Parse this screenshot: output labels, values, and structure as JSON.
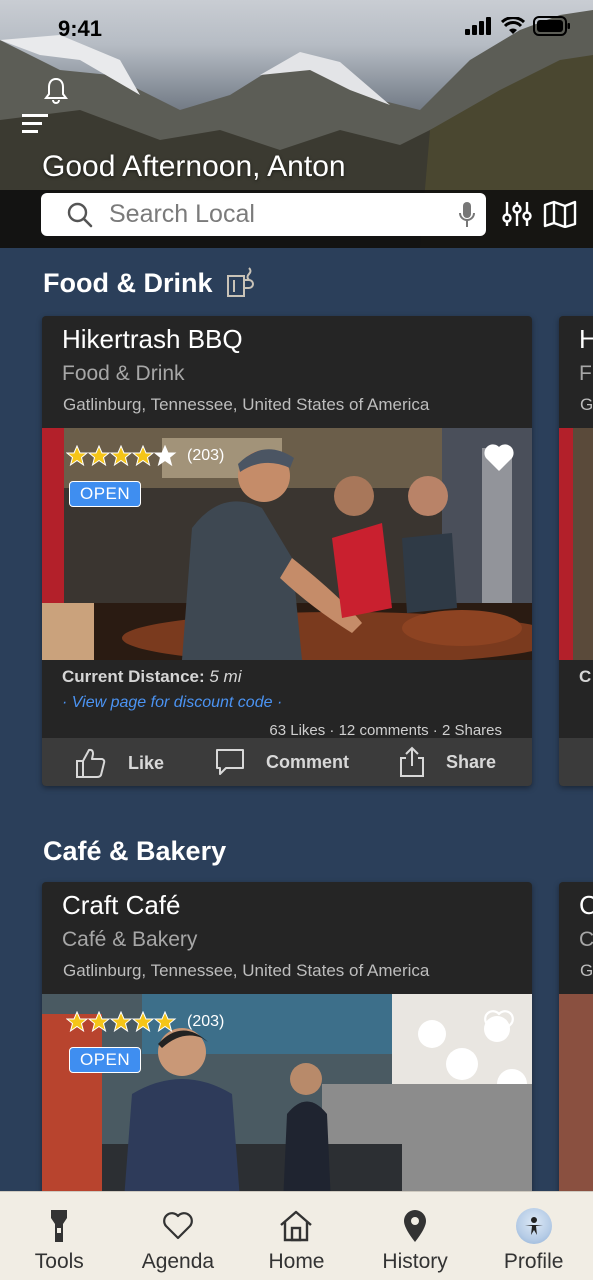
{
  "status": {
    "time": "9:41"
  },
  "header": {
    "greeting": "Good Afternoon, Anton"
  },
  "search": {
    "placeholder": "Search Local"
  },
  "sections": [
    {
      "title": "Food & Drink",
      "card": {
        "name": "Hikertrash BBQ",
        "category": "Food & Drink",
        "location": "Gatlinburg, Tennessee, United States of America",
        "rating": 5,
        "review_count": "(203)",
        "status": "OPEN",
        "distance_label": "Current Distance:",
        "distance_value": "5 mi",
        "discount": "· View page for discount code ·",
        "stats": "63 Likes · 12 comments · 2 Shares",
        "actions": {
          "like": "Like",
          "comment": "Comment",
          "share": "Share"
        }
      },
      "peek": {
        "name_initial": "H",
        "category_initial": "F",
        "location_initial": "G",
        "distance_initial": "C"
      }
    },
    {
      "title": "Café & Bakery",
      "card": {
        "name": "Craft Café",
        "category": "Café & Bakery",
        "location": "Gatlinburg, Tennessee, United States of America",
        "rating": 5,
        "review_count": "(203)",
        "status": "OPEN"
      },
      "peek": {
        "name_initial": "C",
        "category_initial": "C",
        "location_initial": "G"
      }
    }
  ],
  "tabs": [
    {
      "label": "Tools",
      "icon": "flashlight-icon"
    },
    {
      "label": "Agenda",
      "icon": "heart-icon"
    },
    {
      "label": "Home",
      "icon": "home-icon"
    },
    {
      "label": "History",
      "icon": "map-pin-icon"
    },
    {
      "label": "Profile",
      "icon": "avatar"
    }
  ],
  "colors": {
    "background": "#2b3f5a",
    "card": "#252525",
    "accent": "#3f8ef0",
    "star": "#f5c518",
    "tabbar": "#f1ede4"
  }
}
